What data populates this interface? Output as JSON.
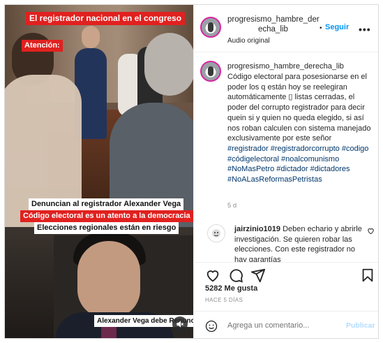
{
  "media": {
    "overlay_title": "El registrador nacional en el congreso",
    "overlay_atencion": "Atención:",
    "overlay_line1": "Denuncian al registrador Alexander Vega",
    "overlay_line2": "Código electoral es un atento a la democracia",
    "overlay_line3": "Elecciones regionales están en riesgo",
    "overlay_bottom": "Alexander Vega debe Renunciar",
    "mute_icon": "speaker-muted-icon"
  },
  "header": {
    "username_line1": "progresismo_hambre_der",
    "username_line2": "echa_lib",
    "separator": "•",
    "follow_label": "Seguir",
    "audio_label": "Audio original",
    "more_label": "•••"
  },
  "caption": {
    "username": "progresismo_hambre_derecha_lib",
    "text": "Código electoral para posesionarse en el poder los q están hoy se reelegiran automáticamente ▯ listas cerradas, el poder del corrupto registrador para decir quein si y quien no queda elegido, si así nos roban calculen con sistema manejado exclusivamente por este señor ",
    "hashtags": "#registrador #registradorcorrupto #codigo #códigelectoral #noalcomunismo #NoMasPetro #dictador #dictadores #NoALasReformasPetristas",
    "time": "5 d"
  },
  "comment": {
    "username": "jairzinio1019",
    "text": " Deben echario y abrirle investigación. Se quieren robar las elecciones. Con este registrador no hay garantías"
  },
  "actions": {
    "likes": "5282 Me gusta",
    "ago": "HACE 5 DÍAS"
  },
  "add_comment": {
    "placeholder": "Agrega un comentario...",
    "post_label": "Publicar"
  },
  "colors": {
    "accent_blue": "#0095f6",
    "overlay_red": "#e0211f",
    "hashtag_blue": "#00376b"
  }
}
